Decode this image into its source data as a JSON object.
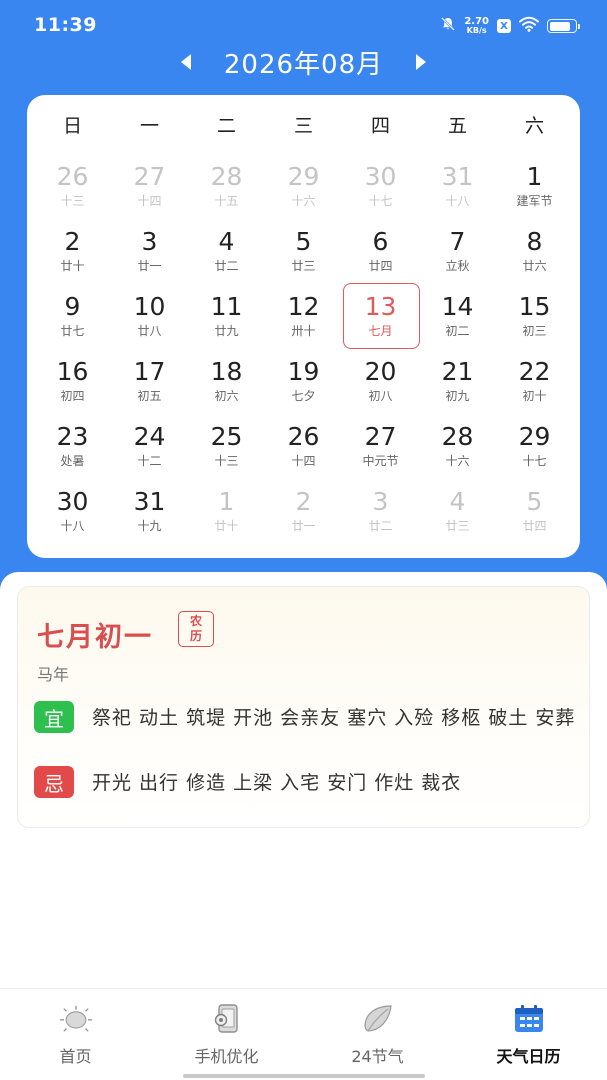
{
  "status_bar": {
    "time": "11:39",
    "net_speed_value": "2.70",
    "net_speed_unit": "KB/s",
    "x_badge": "X",
    "battery_level": 0.8
  },
  "month_nav": {
    "title": "2026年08月",
    "prev_icon": "triangle-left",
    "next_icon": "triangle-right"
  },
  "calendar": {
    "weekdays": [
      "日",
      "一",
      "二",
      "三",
      "四",
      "五",
      "六"
    ],
    "weeks": [
      [
        {
          "day": "26",
          "lunar": "十三",
          "other": true
        },
        {
          "day": "27",
          "lunar": "十四",
          "other": true
        },
        {
          "day": "28",
          "lunar": "十五",
          "other": true
        },
        {
          "day": "29",
          "lunar": "十六",
          "other": true
        },
        {
          "day": "30",
          "lunar": "十七",
          "other": true
        },
        {
          "day": "31",
          "lunar": "十八",
          "other": true
        },
        {
          "day": "1",
          "lunar": "建军节",
          "other": false
        }
      ],
      [
        {
          "day": "2",
          "lunar": "廿十",
          "other": false
        },
        {
          "day": "3",
          "lunar": "廿一",
          "other": false
        },
        {
          "day": "4",
          "lunar": "廿二",
          "other": false
        },
        {
          "day": "5",
          "lunar": "廿三",
          "other": false
        },
        {
          "day": "6",
          "lunar": "廿四",
          "other": false
        },
        {
          "day": "7",
          "lunar": "立秋",
          "other": false
        },
        {
          "day": "8",
          "lunar": "廿六",
          "other": false
        }
      ],
      [
        {
          "day": "9",
          "lunar": "廿七",
          "other": false
        },
        {
          "day": "10",
          "lunar": "廿八",
          "other": false
        },
        {
          "day": "11",
          "lunar": "廿九",
          "other": false
        },
        {
          "day": "12",
          "lunar": "卅十",
          "other": false
        },
        {
          "day": "13",
          "lunar": "七月",
          "other": false,
          "selected": true
        },
        {
          "day": "14",
          "lunar": "初二",
          "other": false
        },
        {
          "day": "15",
          "lunar": "初三",
          "other": false
        }
      ],
      [
        {
          "day": "16",
          "lunar": "初四",
          "other": false
        },
        {
          "day": "17",
          "lunar": "初五",
          "other": false
        },
        {
          "day": "18",
          "lunar": "初六",
          "other": false
        },
        {
          "day": "19",
          "lunar": "七夕",
          "other": false
        },
        {
          "day": "20",
          "lunar": "初八",
          "other": false
        },
        {
          "day": "21",
          "lunar": "初九",
          "other": false
        },
        {
          "day": "22",
          "lunar": "初十",
          "other": false
        }
      ],
      [
        {
          "day": "23",
          "lunar": "处暑",
          "other": false
        },
        {
          "day": "24",
          "lunar": "十二",
          "other": false
        },
        {
          "day": "25",
          "lunar": "十三",
          "other": false
        },
        {
          "day": "26",
          "lunar": "十四",
          "other": false
        },
        {
          "day": "27",
          "lunar": "中元节",
          "other": false
        },
        {
          "day": "28",
          "lunar": "十六",
          "other": false
        },
        {
          "day": "29",
          "lunar": "十七",
          "other": false
        }
      ],
      [
        {
          "day": "30",
          "lunar": "十八",
          "other": false
        },
        {
          "day": "31",
          "lunar": "十九",
          "other": false
        },
        {
          "day": "1",
          "lunar": "廿十",
          "other": true
        },
        {
          "day": "2",
          "lunar": "廿一",
          "other": true
        },
        {
          "day": "3",
          "lunar": "廿二",
          "other": true
        },
        {
          "day": "4",
          "lunar": "廿三",
          "other": true
        },
        {
          "day": "5",
          "lunar": "廿四",
          "other": true
        }
      ]
    ]
  },
  "almanac": {
    "lunar_date": "七月初一",
    "stamp_line1": "农",
    "stamp_line2": "历",
    "year_label": "马年",
    "yi_label": "宜",
    "yi_text": "祭祀 动土 筑堤 开池 会亲友 塞穴 入殓 移柩 破土 安葬",
    "ji_label": "忌",
    "ji_text": "开光 出行 修造 上梁 入宅 安门 作灶 裁衣"
  },
  "bottom_nav": {
    "items": [
      {
        "label": "首页",
        "icon": "sun-icon"
      },
      {
        "label": "手机优化",
        "icon": "phone-gear-icon"
      },
      {
        "label": "24节气",
        "icon": "leaf-icon"
      },
      {
        "label": "天气日历",
        "icon": "calendar-icon",
        "active": true
      }
    ]
  },
  "colors": {
    "primary_blue": "#3a86f0",
    "selected_red": "#e05a5a",
    "yi_green": "#2fbf4e",
    "ji_red": "#e24a4a"
  }
}
